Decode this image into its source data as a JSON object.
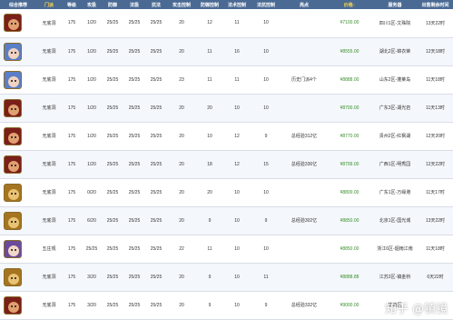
{
  "table": {
    "headers": [
      "综合推荐",
      "门派",
      "等级",
      "攻极",
      "防御",
      "法极",
      "抗法",
      "攻击控制",
      "防御控制",
      "法术控制",
      "法抗控制",
      "亮点",
      "价格↑",
      "服务器",
      "出售剩余时间"
    ],
    "rows": [
      {
        "avatar": "red-helmet",
        "school": "无底洞",
        "level": "175",
        "gong": "1/20",
        "fang": "25/25",
        "fa": "25/25",
        "kang": "25/25",
        "c1": "20",
        "c2": "12",
        "c3": "11",
        "c4": "10",
        "highlight": "",
        "price": "¥7100.00",
        "server": "四川1区-文殊院",
        "time": "13天22时"
      },
      {
        "avatar": "blue-lady",
        "school": "无底洞",
        "level": "175",
        "gong": "1/20",
        "fang": "25/25",
        "fa": "25/25",
        "kang": "25/25",
        "c1": "20",
        "c2": "11",
        "c3": "16",
        "c4": "10",
        "highlight": "",
        "price": "¥8555.00",
        "server": "湖北2区-锦衣荣",
        "time": "12天18时"
      },
      {
        "avatar": "blue-lady",
        "school": "无底洞",
        "level": "175",
        "gong": "1/20",
        "fang": "25/25",
        "fa": "25/25",
        "kang": "25/25",
        "c1": "23",
        "c2": "11",
        "c3": "11",
        "c4": "10",
        "highlight": "历史门派4个",
        "price": "¥8888.00",
        "server": "山东2区-蓬莱岛",
        "time": "11天18时"
      },
      {
        "avatar": "red-helmet",
        "school": "无底洞",
        "level": "175",
        "gong": "1/20",
        "fang": "25/25",
        "fa": "25/25",
        "kang": "25/25",
        "c1": "20",
        "c2": "20",
        "c3": "10",
        "c4": "10",
        "highlight": "",
        "price": "¥8700.00",
        "server": "广东3区-湖光岩",
        "time": "11天13时"
      },
      {
        "avatar": "red-helmet",
        "school": "无底洞",
        "level": "175",
        "gong": "1/20",
        "fang": "25/25",
        "fa": "25/25",
        "kang": "25/25",
        "c1": "20",
        "c2": "10",
        "c3": "12",
        "c4": "9",
        "highlight": "总经验312亿",
        "price": "¥8770.00",
        "server": "贵州2区-红枫湖",
        "time": "12天20时"
      },
      {
        "avatar": "red-helmet",
        "school": "无底洞",
        "level": "175",
        "gong": "1/20",
        "fang": "25/25",
        "fa": "25/25",
        "kang": "25/25",
        "c1": "20",
        "c2": "18",
        "c3": "12",
        "c4": "15",
        "highlight": "总经验336亿",
        "price": "¥8799.00",
        "server": "广西1区-明秀园",
        "time": "12天22时"
      },
      {
        "avatar": "gold-mask",
        "school": "无底洞",
        "level": "175",
        "gong": "0/20",
        "fang": "25/25",
        "fa": "25/25",
        "kang": "25/25",
        "c1": "20",
        "c2": "20",
        "c3": "10",
        "c4": "10",
        "highlight": "",
        "price": "¥8800.00",
        "server": "广东1区-万缘港",
        "time": "11天17时"
      },
      {
        "avatar": "gold-mask",
        "school": "无底洞",
        "level": "175",
        "gong": "6/20",
        "fang": "25/25",
        "fa": "25/25",
        "kang": "25/25",
        "c1": "20",
        "c2": "9",
        "c3": "10",
        "c4": "9",
        "highlight": "总经验302亿",
        "price": "¥8850.00",
        "server": "北京1区-国光城",
        "time": "13天22时"
      },
      {
        "avatar": "purple-sage",
        "school": "五庄观",
        "level": "175",
        "gong": "25/25",
        "fang": "25/25",
        "fa": "25/25",
        "kang": "25/25",
        "c1": "22",
        "c2": "11",
        "c3": "10",
        "c4": "10",
        "highlight": "",
        "price": "¥8850.00",
        "server": "浙江6区-烟雨江南",
        "time": "11天18时"
      },
      {
        "avatar": "gold-mask",
        "school": "无底洞",
        "level": "175",
        "gong": "3/20",
        "fang": "25/25",
        "fa": "25/25",
        "kang": "25/25",
        "c1": "20",
        "c2": "9",
        "c3": "10",
        "c4": "11",
        "highlight": "",
        "price": "¥8888.88",
        "server": "江苏3区-镇金桥",
        "time": "6天22时"
      },
      {
        "avatar": "red-helmet",
        "school": "无底洞",
        "level": "175",
        "gong": "3/20",
        "fang": "25/25",
        "fa": "25/25",
        "kang": "25/25",
        "c1": "20",
        "c2": "9",
        "c3": "10",
        "c4": "9",
        "highlight": "总经验332亿",
        "price": "¥9000.00",
        "server": "华南区",
        "time": ""
      }
    ]
  },
  "watermark": "知乎 @镇镜",
  "colors": {
    "header_bg": "#4a6a93",
    "price": "#3a8f2c",
    "accent": "#ffd84d"
  }
}
